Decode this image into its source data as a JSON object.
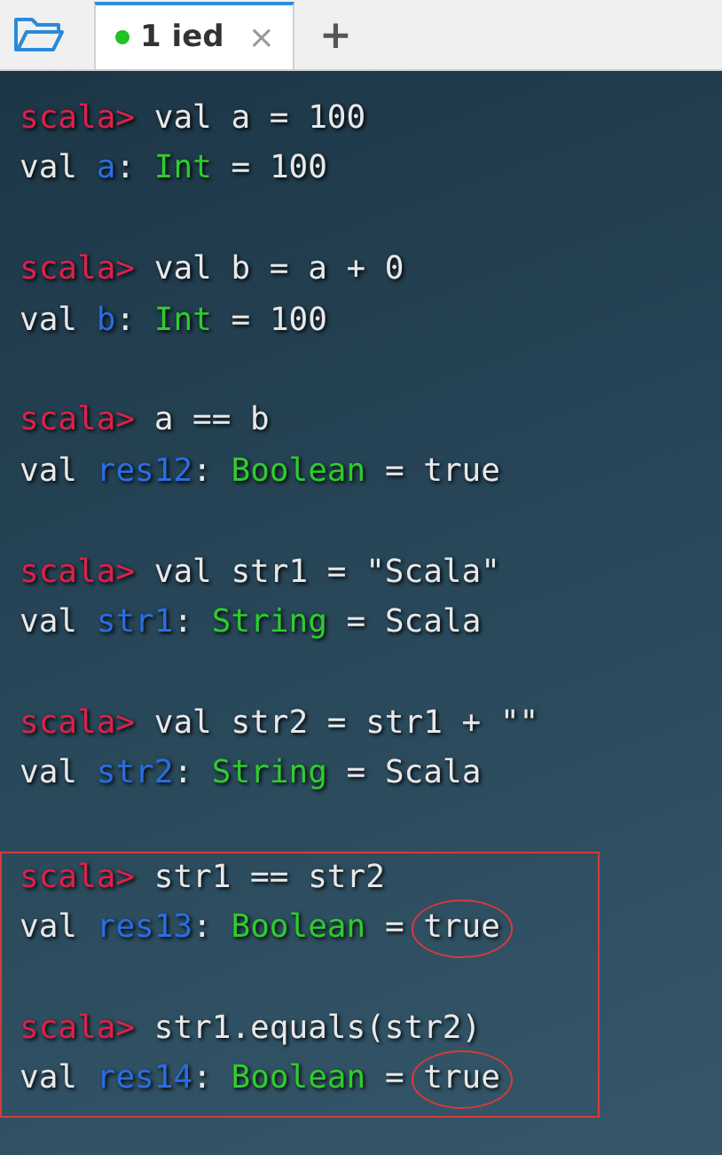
{
  "tabs": [
    {
      "label": "1 ied",
      "selected": true,
      "connected": true,
      "close": "×"
    }
  ],
  "new_tab": "+",
  "entries": [
    {
      "prompt": "scala>",
      "input": "val a = 100",
      "keyword": "val",
      "name": "a",
      "type": "Int",
      "colon": ":",
      "equals": "=",
      "value": "100",
      "highlighted": false,
      "circled": false
    },
    {
      "prompt": "scala>",
      "input": "val b = a + 0",
      "keyword": "val",
      "name": "b",
      "type": "Int",
      "colon": ":",
      "equals": "=",
      "value": "100",
      "highlighted": false,
      "circled": false
    },
    {
      "prompt": "scala>",
      "input": "a == b",
      "keyword": "val",
      "name": "res12",
      "type": "Boolean",
      "colon": ":",
      "equals": "=",
      "value": "true",
      "highlighted": false,
      "circled": false
    },
    {
      "prompt": "scala>",
      "input": "val str1 = \"Scala\"",
      "keyword": "val",
      "name": "str1",
      "type": "String",
      "colon": ":",
      "equals": "=",
      "value": "Scala",
      "highlighted": false,
      "circled": false
    },
    {
      "prompt": "scala>",
      "input": "val str2 = str1 + \"\"",
      "keyword": "val",
      "name": "str2",
      "type": "String",
      "colon": ":",
      "equals": "=",
      "value": "Scala",
      "highlighted": false,
      "circled": false
    },
    {
      "prompt": "scala>",
      "input": "str1 == str2",
      "keyword": "val",
      "name": "res13",
      "type": "Boolean",
      "colon": ":",
      "equals": "=",
      "value": "true",
      "highlighted": true,
      "circled": true
    },
    {
      "prompt": "scala>",
      "input": "str1.equals(str2)",
      "keyword": "val",
      "name": "res14",
      "type": "Boolean",
      "colon": ":",
      "equals": "=",
      "value": "true",
      "highlighted": true,
      "circled": true
    }
  ]
}
